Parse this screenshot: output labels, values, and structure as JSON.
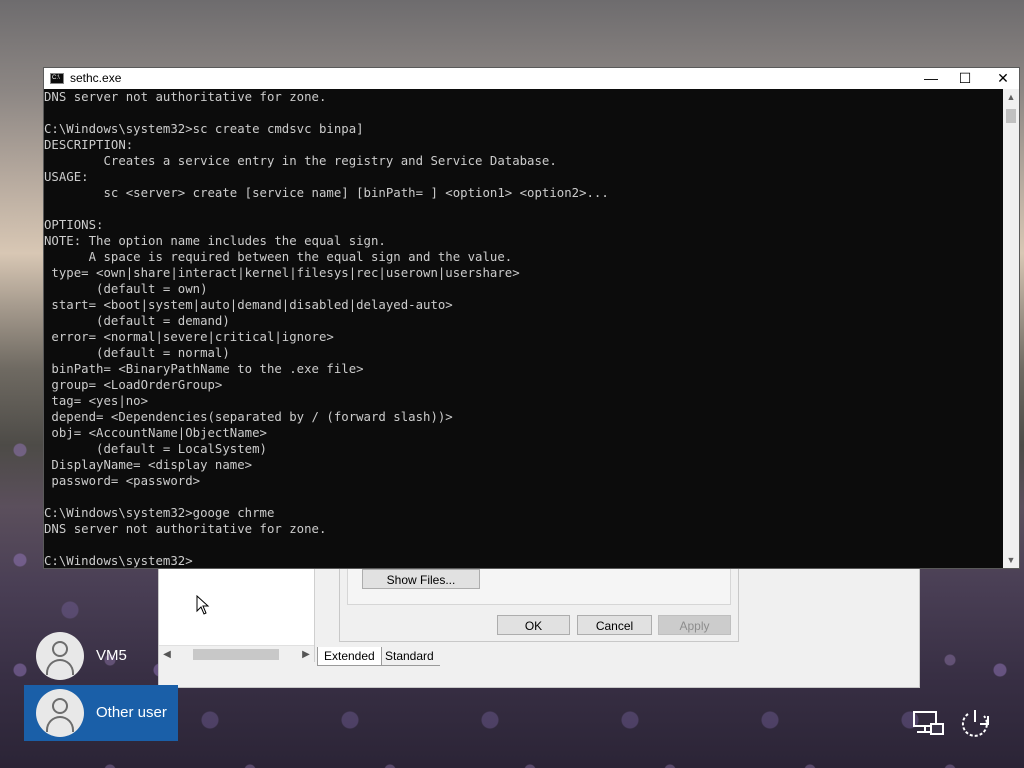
{
  "console": {
    "title": "sethc.exe",
    "lines": [
      "DNS server not authoritative for zone.",
      "",
      "C:\\Windows\\system32>sc create cmdsvc binpa]",
      "DESCRIPTION:",
      "        Creates a service entry in the registry and Service Database.",
      "USAGE:",
      "        sc <server> create [service name] [binPath= ] <option1> <option2>...",
      "",
      "OPTIONS:",
      "NOTE: The option name includes the equal sign.",
      "      A space is required between the equal sign and the value.",
      " type= <own|share|interact|kernel|filesys|rec|userown|usershare>",
      "       (default = own)",
      " start= <boot|system|auto|demand|disabled|delayed-auto>",
      "       (default = demand)",
      " error= <normal|severe|critical|ignore>",
      "       (default = normal)",
      " binPath= <BinaryPathName to the .exe file>",
      " group= <LoadOrderGroup>",
      " tag= <yes|no>",
      " depend= <Dependencies(separated by / (forward slash))>",
      " obj= <AccountName|ObjectName>",
      "       (default = LocalSystem)",
      " DisplayName= <display name>",
      " password= <password>",
      "",
      "C:\\Windows\\system32>googe chrme",
      "DNS server not authoritative for zone.",
      "",
      "C:\\Windows\\system32>"
    ]
  },
  "background_dialog": {
    "show_files_label": "Show Files...",
    "ok_label": "OK",
    "cancel_label": "Cancel",
    "apply_label": "Apply",
    "tab_extended": "Extended",
    "tab_standard": "Standard"
  },
  "login": {
    "users": [
      {
        "name": "VM5",
        "selected": false
      },
      {
        "name": "Other user",
        "selected": true
      }
    ]
  },
  "icons": {
    "network": "network-icon",
    "power_accessibility": "ease-of-access-power-icon"
  },
  "colors": {
    "console_bg": "#0c0c0c",
    "console_text": "#cccccc",
    "selected_user": "#1a5fa8"
  }
}
